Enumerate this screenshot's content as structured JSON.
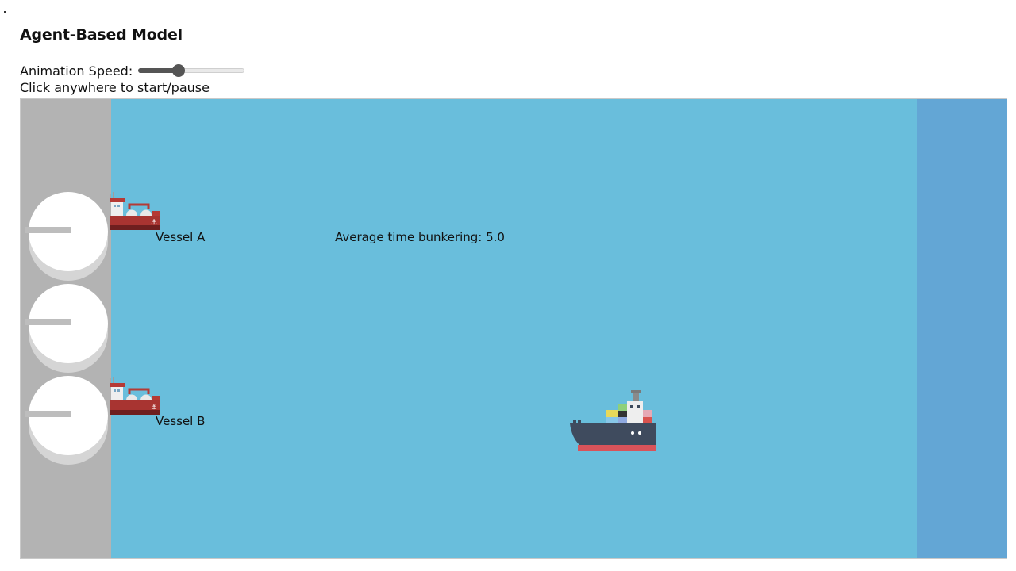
{
  "header": {
    "title": "Agent-Based Model"
  },
  "controls": {
    "speed_label": "Animation Speed:",
    "speed_fraction": 0.36,
    "hint": "Click anywhere to start/pause"
  },
  "simulation": {
    "colors": {
      "dock": "#b3b3b3",
      "water": "#69bedc",
      "deep_water": "#63a6d5",
      "tank": "#ffffff"
    },
    "tanks": [
      "storage-tank",
      "storage-tank",
      "storage-tank"
    ],
    "vessels": [
      {
        "label": "Vessel A",
        "icon": "bunker-vessel-icon"
      },
      {
        "label": "Vessel B",
        "icon": "bunker-vessel-icon"
      }
    ],
    "stats": {
      "average_label": "Average time bunkering: 5.0"
    },
    "client_ship": {
      "icon": "container-ship-icon"
    }
  }
}
